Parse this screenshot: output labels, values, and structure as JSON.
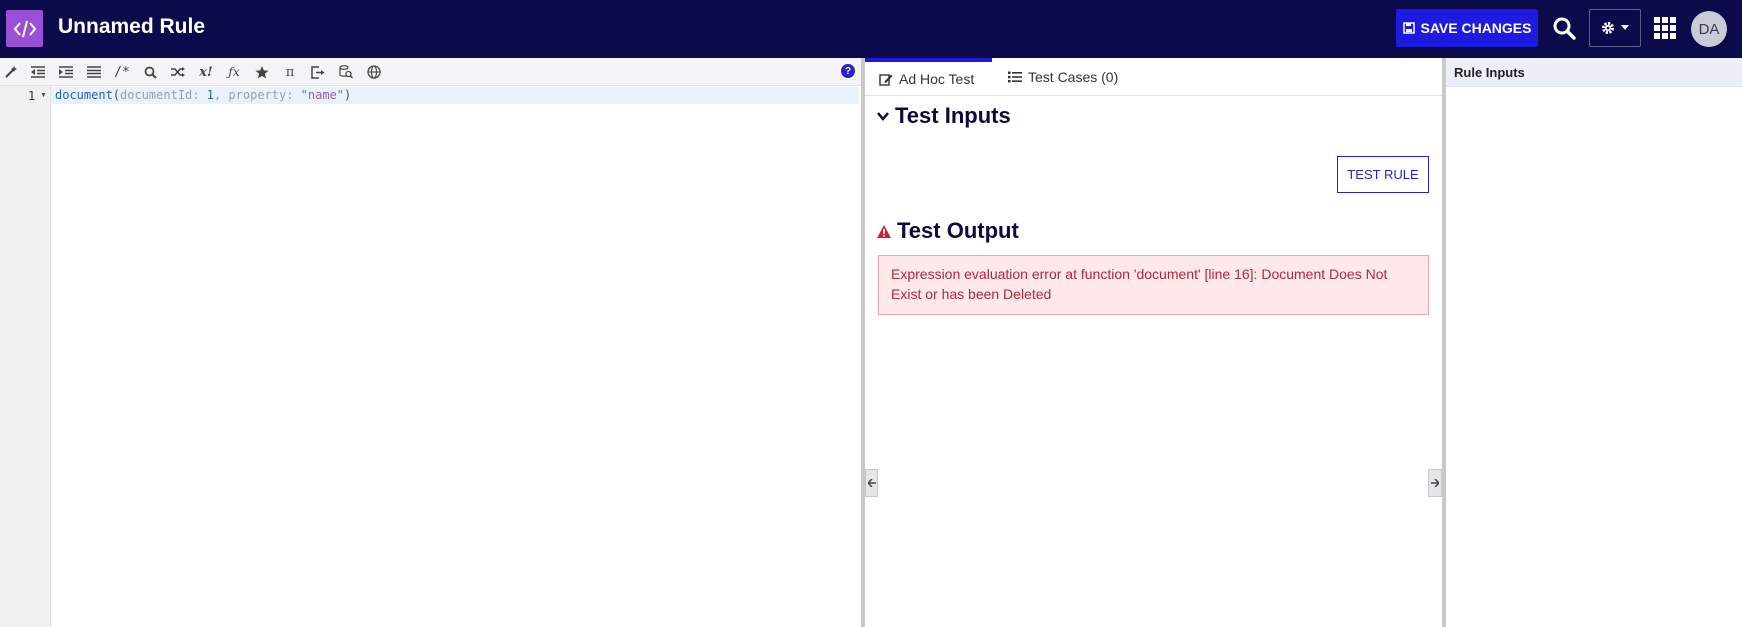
{
  "header": {
    "title": "Unnamed Rule",
    "save_label": "SAVE CHANGES",
    "avatar_initials": "DA"
  },
  "editor": {
    "toolbar_icons": [
      "magic-wand-icon",
      "outdent-icon",
      "indent-icon",
      "list-icon",
      "comment-icon",
      "search-icon",
      "shuffle-icon",
      "variable-icon",
      "function-icon",
      "star-icon",
      "pi-icon",
      "export-icon",
      "search-db-icon",
      "globe-icon"
    ],
    "line_number": "1",
    "code": {
      "fn": "document",
      "open": "(",
      "param1": "documentId",
      "colon1": ": ",
      "value1": "1",
      "comma": ", ",
      "param2": "property",
      "colon2": ": ",
      "value2": "\"name\"",
      "close": ")"
    }
  },
  "test_panel": {
    "tabs": [
      {
        "label": "Ad Hoc Test",
        "active": true
      },
      {
        "label": "Test Cases (0)",
        "active": false
      }
    ],
    "inputs_heading": "Test Inputs",
    "test_rule_label": "TEST RULE",
    "output_heading": "Test Output",
    "error_message": "Expression evaluation error at function 'document' [line 16]: Document Does Not Exist or has been Deleted"
  },
  "rule_inputs": {
    "heading": "Rule Inputs"
  },
  "colors": {
    "header_bg": "#0b0a4a",
    "accent": "#1f1ae0",
    "logo": "#9a4fd7",
    "error_text": "#b1283c",
    "error_bg": "#fde8ea"
  }
}
